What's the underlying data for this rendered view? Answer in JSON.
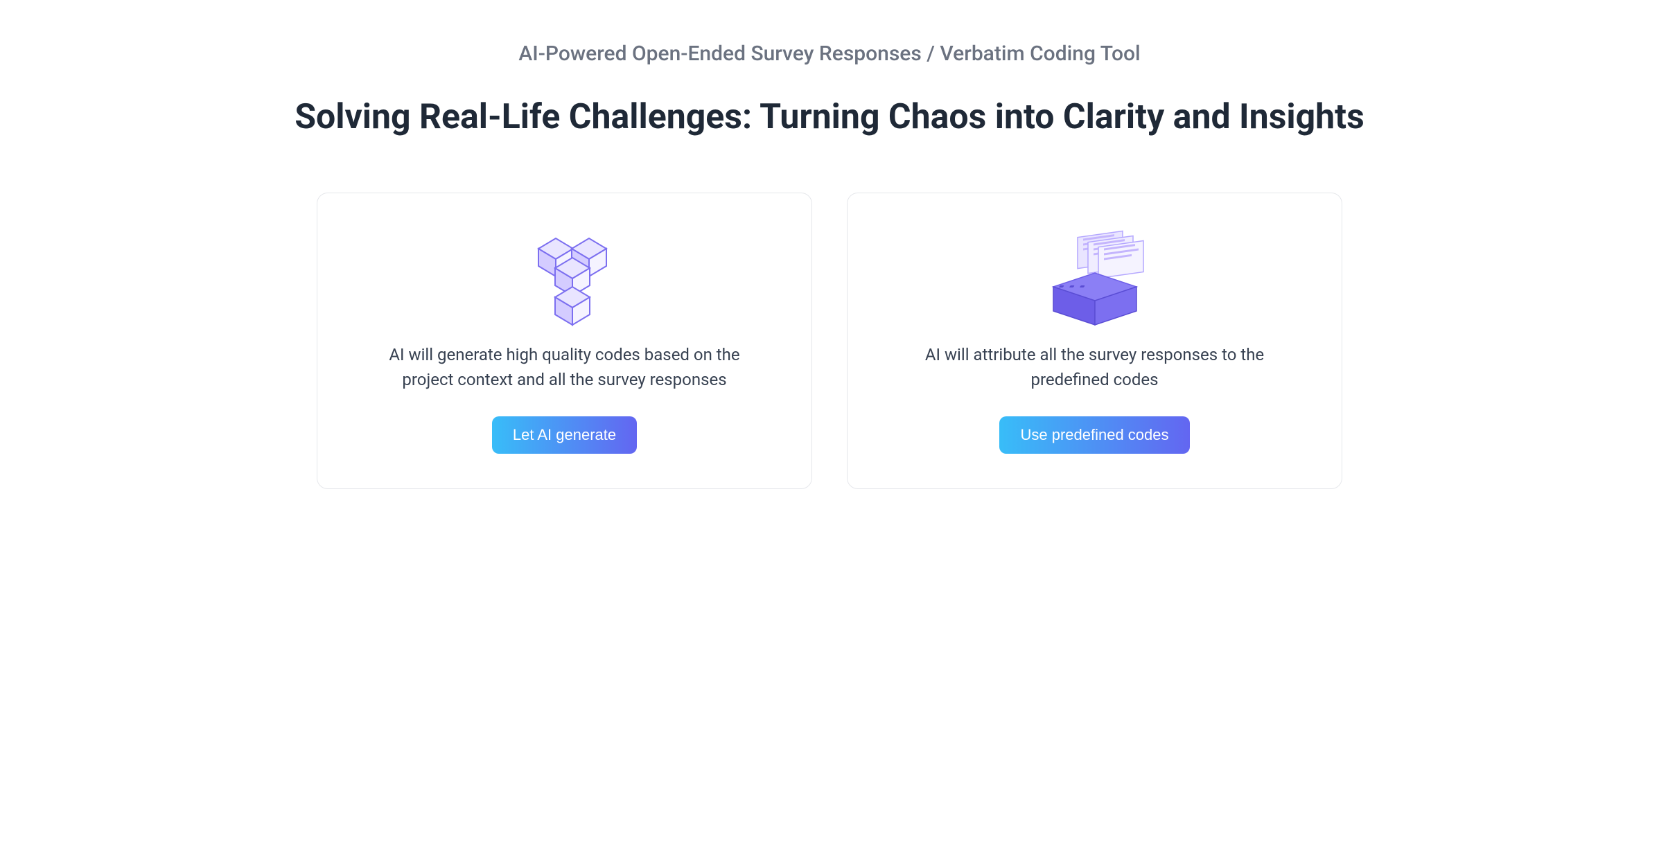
{
  "header": {
    "subtitle": "AI-Powered Open-Ended Survey Responses / Verbatim Coding Tool",
    "title": "Solving Real-Life Challenges: Turning Chaos into Clarity and Insights"
  },
  "cards": [
    {
      "icon": "cubes-icon",
      "description": "AI will generate high quality codes based on the project context and all the survey responses",
      "button_label": "Let AI generate"
    },
    {
      "icon": "filing-box-icon",
      "description": "AI will attribute all the survey responses to the predefined codes",
      "button_label": "Use predefined codes"
    }
  ],
  "colors": {
    "button_gradient_start": "#38bdf8",
    "button_gradient_end": "#6366f1",
    "icon_primary": "#7c6ff0",
    "icon_light": "#e0e7ff"
  }
}
